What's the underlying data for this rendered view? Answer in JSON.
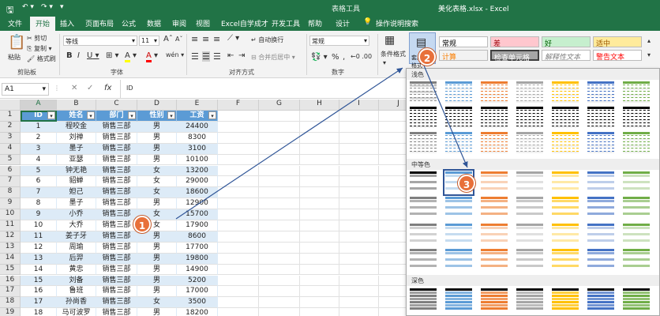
{
  "window": {
    "context_tab": "表格工具",
    "file_title": "美化表格.xlsx  -  Excel"
  },
  "tabs": [
    "文件",
    "开始",
    "插入",
    "页面布局",
    "公式",
    "数据",
    "审阅",
    "视图",
    "Excel自学成才",
    "开发工具",
    "帮助",
    "设计"
  ],
  "tell_me": "操作说明搜索",
  "ribbon": {
    "clipboard": {
      "paste": "粘贴",
      "cut": "剪切",
      "copy": "复制",
      "format_painter": "格式刷",
      "label": "剪贴板"
    },
    "font": {
      "name": "等线",
      "size": "11",
      "bold": "B",
      "italic": "I",
      "underline": "U",
      "grow": "A",
      "shrink": "A",
      "fill": "A",
      "color": "A",
      "phonetic": "wén",
      "label": "字体"
    },
    "alignment": {
      "wrap": "自动换行",
      "merge": "合并后居中",
      "label": "对齐方式"
    },
    "number": {
      "format": "常规",
      "percent": "%",
      "comma": ",",
      "label": "数字"
    },
    "cond_format": "条件格式",
    "table_format": "套用表格格式",
    "styles": [
      {
        "text": "常规",
        "bg": "#ffffff",
        "fg": "#000000"
      },
      {
        "text": "差",
        "bg": "#ffc7ce",
        "fg": "#9c0006"
      },
      {
        "text": "好",
        "bg": "#c6efce",
        "fg": "#006100"
      },
      {
        "text": "适中",
        "bg": "#ffeb9c",
        "fg": "#9c5700"
      },
      {
        "text": "计算",
        "bg": "#f2f2f2",
        "fg": "#fa7d00"
      },
      {
        "text": "检查单元格",
        "bg": "#a5a5a5",
        "fg": "#ffffff"
      },
      {
        "text": "解释性文本",
        "bg": "#ffffff",
        "fg": "#7f7f7f"
      },
      {
        "text": "警告文本",
        "bg": "#ffffff",
        "fg": "#ff0000"
      }
    ]
  },
  "formula": {
    "name_box": "A1",
    "fx": "fx",
    "value": "ID"
  },
  "sheet": {
    "columns": [
      "A",
      "B",
      "C",
      "D",
      "E",
      "F",
      "G",
      "H",
      "I",
      "J"
    ],
    "rows": [
      [
        "ID",
        "姓名",
        "部门",
        "性别",
        "工资"
      ],
      [
        "1",
        "程咬金",
        "销售三部",
        "男",
        "24400"
      ],
      [
        "2",
        "刘禅",
        "销售三部",
        "男",
        "8300"
      ],
      [
        "3",
        "墨子",
        "销售三部",
        "男",
        "3100"
      ],
      [
        "4",
        "亚瑟",
        "销售三部",
        "男",
        "10100"
      ],
      [
        "5",
        "钟无艳",
        "销售三部",
        "女",
        "13200"
      ],
      [
        "6",
        "貂蝉",
        "销售三部",
        "女",
        "29000"
      ],
      [
        "7",
        "妲己",
        "销售三部",
        "女",
        "18600"
      ],
      [
        "8",
        "墨子",
        "销售三部",
        "男",
        "12900"
      ],
      [
        "9",
        "小乔",
        "销售三部",
        "女",
        "15700"
      ],
      [
        "10",
        "大乔",
        "销售三部",
        "女",
        "17900"
      ],
      [
        "11",
        "姜子牙",
        "销售三部",
        "男",
        "8600"
      ],
      [
        "12",
        "周瑜",
        "销售三部",
        "男",
        "17700"
      ],
      [
        "13",
        "后羿",
        "销售三部",
        "男",
        "19800"
      ],
      [
        "14",
        "黄忠",
        "销售三部",
        "男",
        "14900"
      ],
      [
        "15",
        "刘备",
        "销售三部",
        "男",
        "5200"
      ],
      [
        "16",
        "鲁班",
        "销售三部",
        "男",
        "17000"
      ],
      [
        "17",
        "孙尚香",
        "销售三部",
        "女",
        "3500"
      ],
      [
        "18",
        "马可波罗",
        "销售三部",
        "男",
        "18200"
      ]
    ]
  },
  "gallery": {
    "light": "浅色",
    "medium": "中等色",
    "dark": "深色",
    "palette": [
      "#7f7f7f",
      "#5b9bd5",
      "#ed7d31",
      "#a5a5a5",
      "#ffc000",
      "#4472c4",
      "#70ad47"
    ]
  },
  "callouts": [
    "1",
    "2",
    "3"
  ]
}
